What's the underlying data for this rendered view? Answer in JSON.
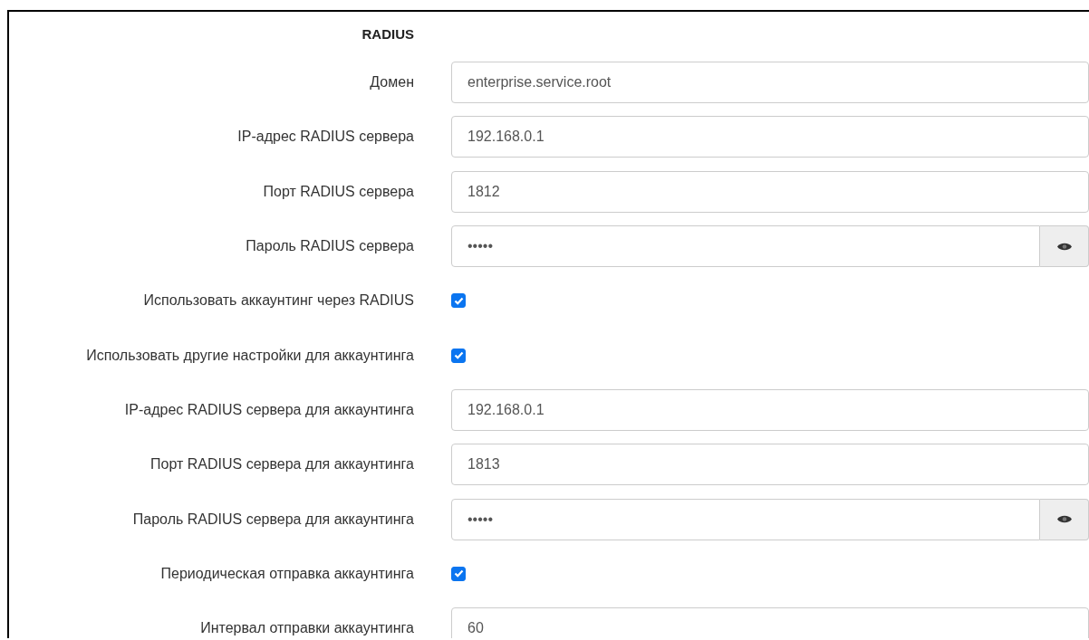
{
  "section_title": "RADIUS",
  "rows": [
    {
      "kind": "text",
      "label": "Домен",
      "value": "enterprise.service.root"
    },
    {
      "kind": "text",
      "label": "IP-адрес RADIUS сервера",
      "value": "192.168.0.1"
    },
    {
      "kind": "text",
      "label": "Порт RADIUS сервера",
      "value": "1812"
    },
    {
      "kind": "password",
      "label": "Пароль RADIUS сервера",
      "value": "•••••"
    },
    {
      "kind": "checkbox",
      "label": "Использовать аккаунтинг через RADIUS",
      "checked": true
    },
    {
      "kind": "checkbox",
      "label": "Использовать другие настройки для аккаунтинга",
      "checked": true
    },
    {
      "kind": "text",
      "label": "IP-адрес RADIUS сервера для аккаунтинга",
      "value": "192.168.0.1"
    },
    {
      "kind": "text",
      "label": "Порт RADIUS сервера для аккаунтинга",
      "value": "1813"
    },
    {
      "kind": "password",
      "label": "Пароль RADIUS сервера для аккаунтинга",
      "value": "•••••"
    },
    {
      "kind": "checkbox",
      "label": "Периодическая отправка аккаунтинга",
      "checked": true
    },
    {
      "kind": "text",
      "label": "Интервал отправки аккаунтинга",
      "value": "60"
    }
  ]
}
